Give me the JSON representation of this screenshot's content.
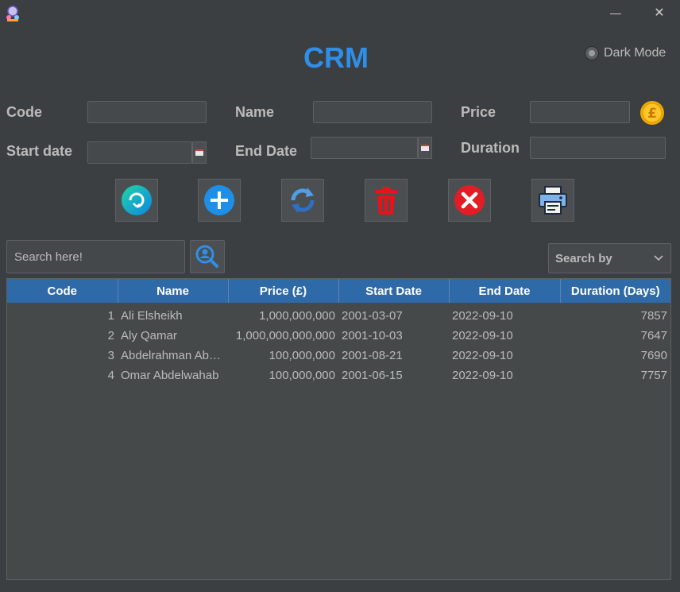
{
  "window": {
    "minimize_glyph": "—",
    "close_glyph": "✕"
  },
  "header": {
    "title": "CRM",
    "dark_mode_label": "Dark Mode"
  },
  "form": {
    "code_label": "Code",
    "name_label": "Name",
    "price_label": "Price",
    "start_date_label": "Start date",
    "end_date_label": "End Date",
    "duration_label": "Duration",
    "code_value": "",
    "name_value": "",
    "price_value": "",
    "start_date_value": "",
    "end_date_value": "",
    "duration_value": ""
  },
  "toolbar": {
    "buttons": [
      "refresh-icon",
      "add-icon",
      "update-icon",
      "delete-icon",
      "clear-icon",
      "print-icon"
    ]
  },
  "search": {
    "placeholder": "Search here!",
    "search_by_label": "Search by"
  },
  "table": {
    "columns": [
      "Code",
      "Name",
      "Price (£)",
      "Start Date",
      "End Date",
      "Duration (Days)"
    ],
    "rows": [
      [
        "1",
        "Ali Elsheikh",
        "1,000,000,000",
        "2001-03-07",
        "2022-09-10",
        "7857"
      ],
      [
        "2",
        "Aly Qamar",
        "1,000,000,000,000",
        "2001-10-03",
        "2022-09-10",
        "7647"
      ],
      [
        "3",
        "Abdelrahman Abd...",
        "100,000,000",
        "2001-08-21",
        "2022-09-10",
        "7690"
      ],
      [
        "4",
        "Omar Abdelwahab",
        "100,000,000",
        "2001-06-15",
        "2022-09-10",
        "7757"
      ]
    ]
  },
  "colors": {
    "background": "#3c3f41",
    "accent": "#2f8fe8",
    "table_header": "#2f6aa8"
  }
}
